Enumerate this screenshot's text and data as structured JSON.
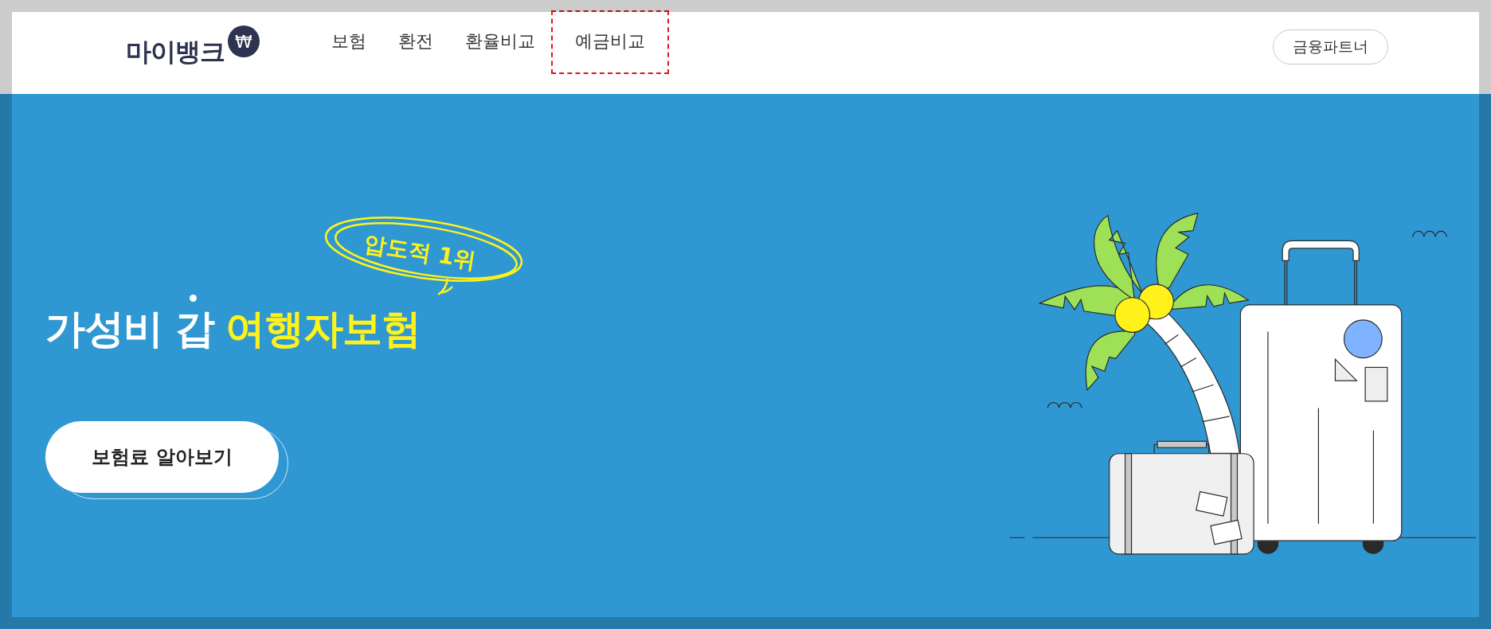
{
  "header": {
    "logo": {
      "text": "마이뱅크",
      "badge": "₩"
    },
    "nav": [
      {
        "label": "보험",
        "selected": false
      },
      {
        "label": "환전",
        "selected": false
      },
      {
        "label": "환율비교",
        "selected": false
      },
      {
        "label": "예금비교",
        "selected": true
      }
    ],
    "partner_button": "금융파트너"
  },
  "hero": {
    "badge": "압도적 1위",
    "headline": [
      {
        "text": "가성비 갑",
        "kind": "plain"
      },
      {
        "text": "여행자보험",
        "kind": "highlight"
      }
    ],
    "cta_button": "보험료 알아보기"
  }
}
